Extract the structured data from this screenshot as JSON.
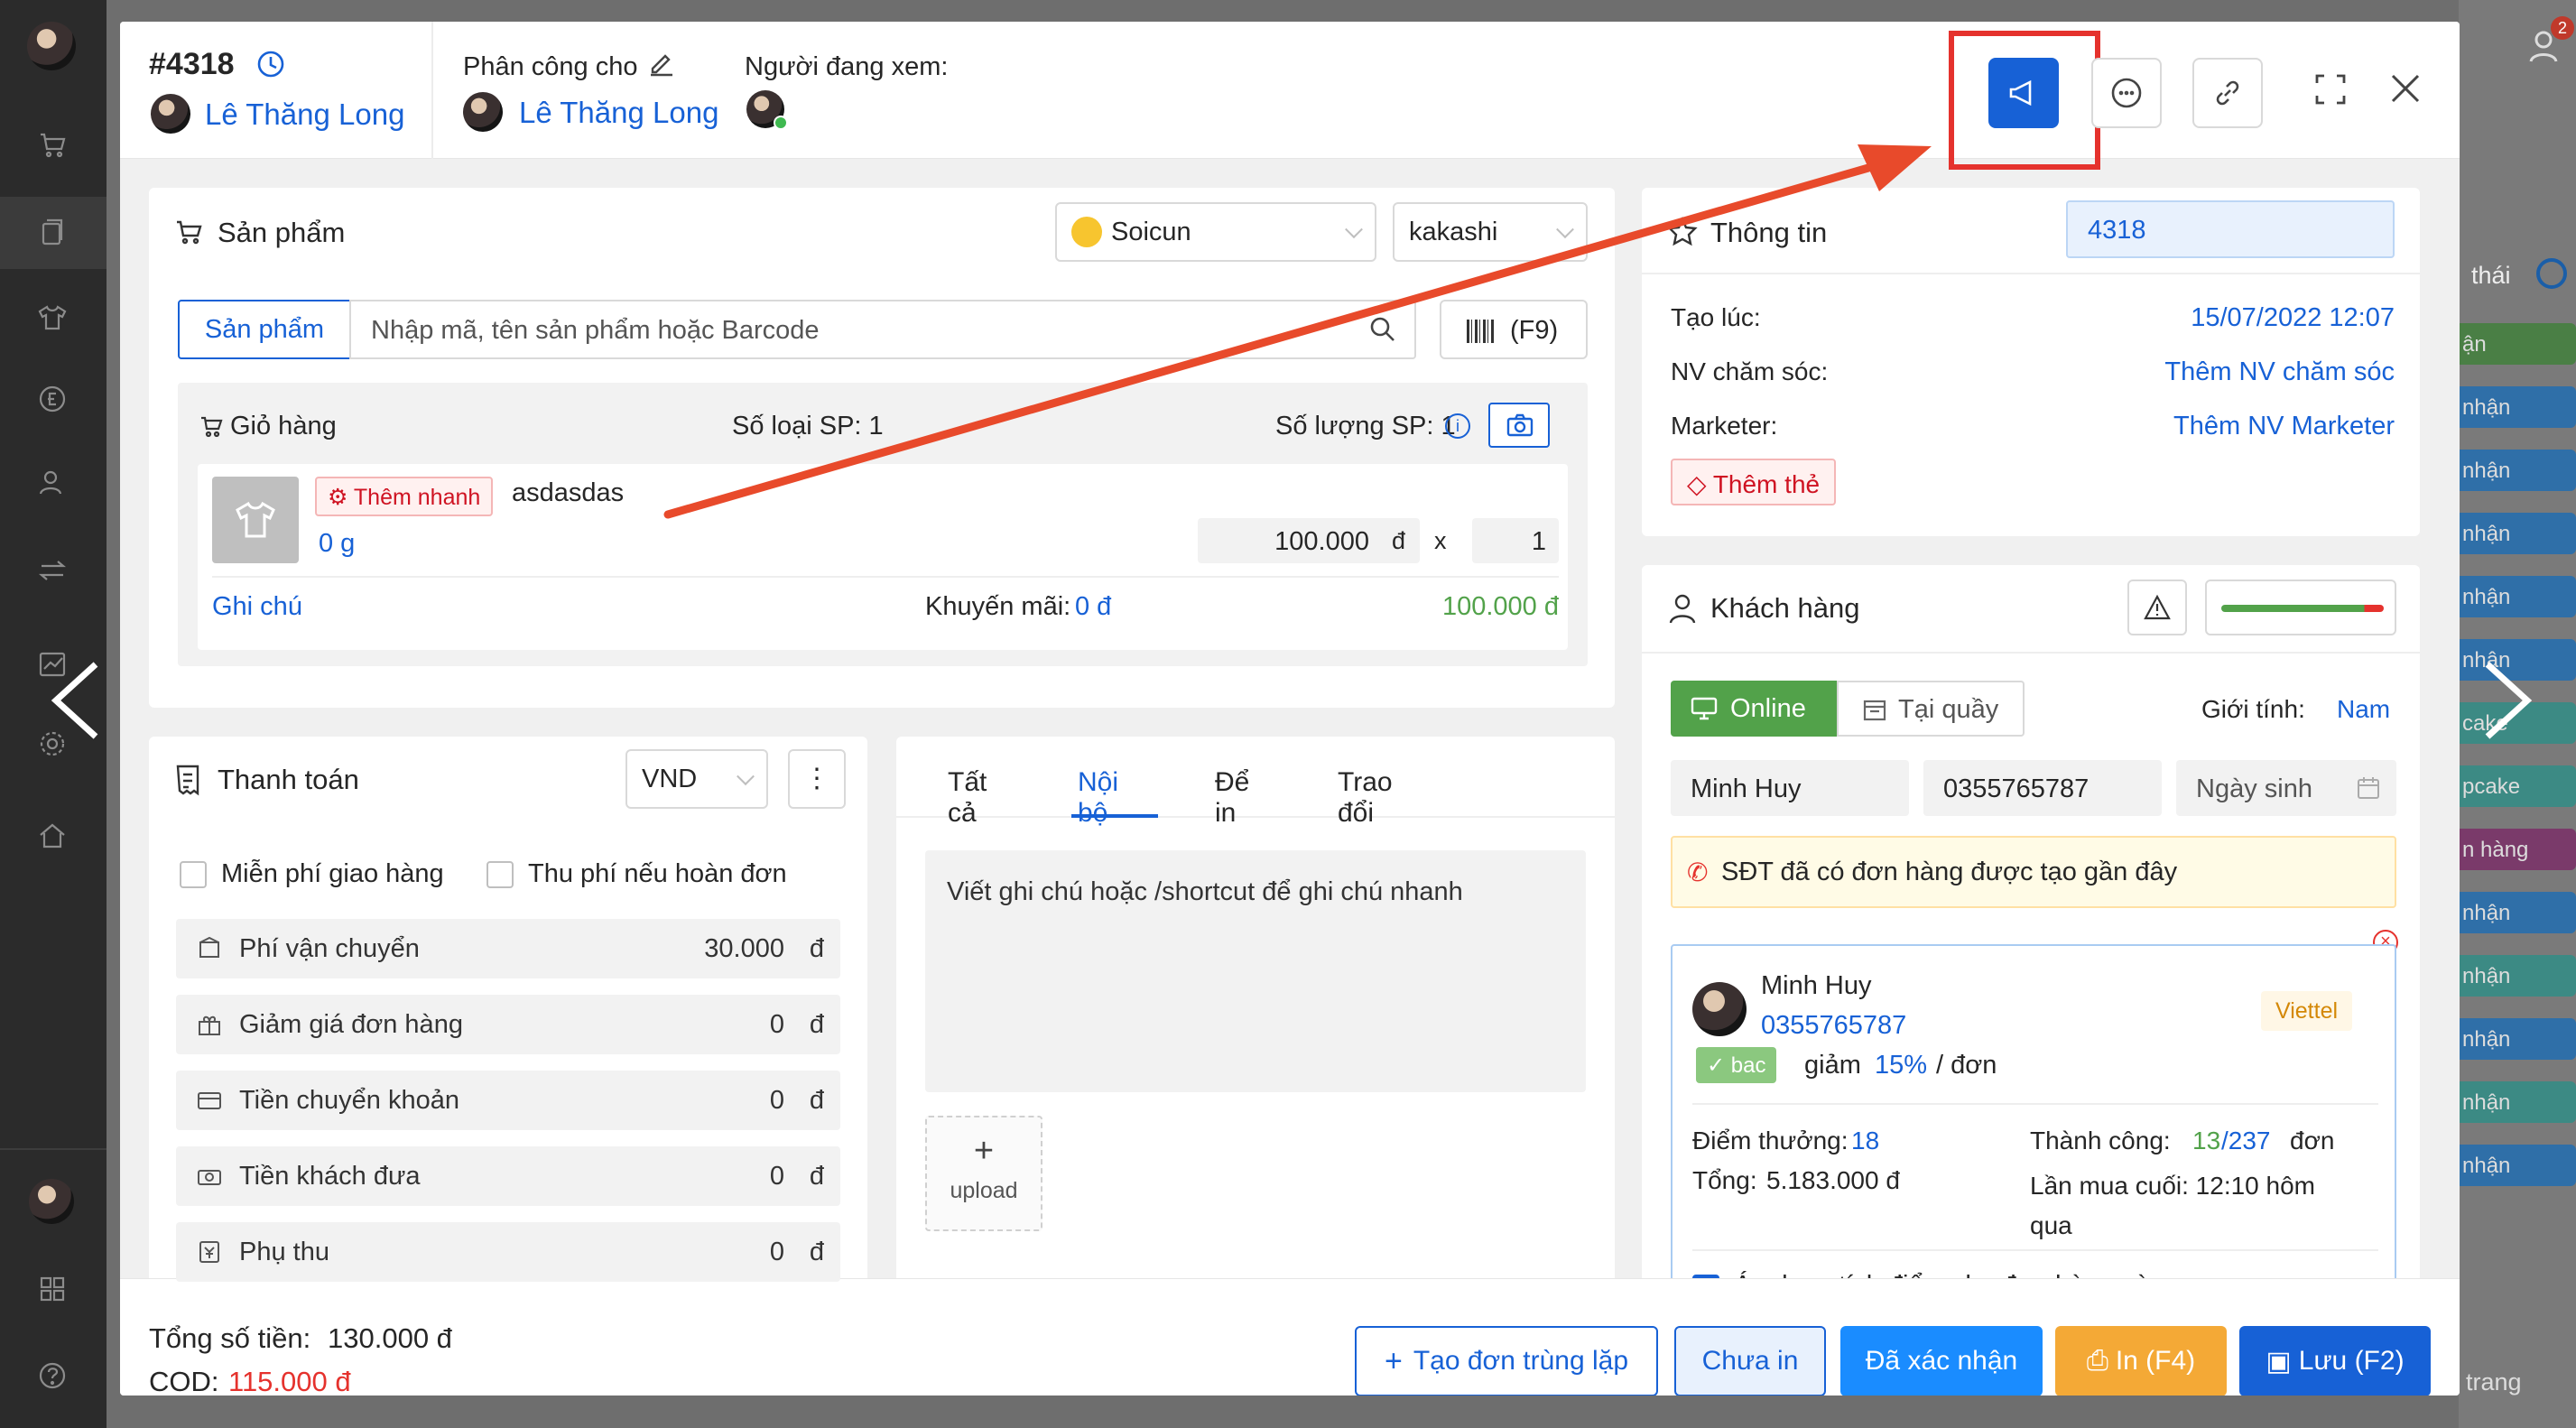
{
  "header": {
    "order_id": "#4318",
    "creator": "Lê Thăng Long",
    "assign_label": "Phân công cho",
    "assignee": "Lê Thăng Long",
    "viewers_label": "Người đang xem:"
  },
  "products": {
    "title": "Sản phẩm",
    "page_select": "Soicun",
    "warehouse_select": "kakashi",
    "tab_label": "Sản phẩm",
    "search_placeholder": "Nhập mã, tên sản phẩm hoặc Barcode",
    "barcode_label": "(F9)",
    "cart_label": "Giỏ hàng",
    "types_count": "Số loại SP: 1",
    "qty_count": "Số lượng SP: 1",
    "item": {
      "quick_add": "Thêm nhanh",
      "name": "asdasdas",
      "weight": "0 g",
      "price": "100.000",
      "currency": "đ",
      "times": "x",
      "qty": "1",
      "note_label": "Ghi chú",
      "discount_label": "Khuyến mãi:",
      "discount_value": "0 đ",
      "total": "100.000 đ"
    }
  },
  "payment": {
    "title": "Thanh toán",
    "currency": "VND",
    "more": "⋮",
    "free_ship": "Miễn phí giao hàng",
    "charge_on_return": "Thu phí nếu hoàn đơn",
    "rows": [
      {
        "label": "Phí vận chuyển",
        "value": "30.000",
        "cur": "đ"
      },
      {
        "label": "Giảm giá đơn hàng",
        "value": "0",
        "cur": "đ"
      },
      {
        "label": "Tiền chuyển khoản",
        "value": "0",
        "cur": "đ"
      },
      {
        "label": "Tiền khách đưa",
        "value": "0",
        "cur": "đ"
      },
      {
        "label": "Phụ thu",
        "value": "0",
        "cur": "đ"
      }
    ]
  },
  "notes": {
    "tabs": [
      "Tất cả",
      "Nội bộ",
      "Để in",
      "Trao đổi"
    ],
    "active_tab": "Nội bộ",
    "placeholder": "Viết ghi chú hoặc /shortcut để ghi chú nhanh",
    "upload_icon": "+",
    "upload": "upload"
  },
  "info": {
    "title": "Thông tin",
    "id_value": "4318",
    "created_label": "Tạo lúc:",
    "created_value": "15/07/2022 12:07",
    "care_label": "NV chăm sóc:",
    "care_value": "Thêm NV chăm sóc",
    "marketer_label": "Marketer:",
    "marketer_value": "Thêm NV Marketer",
    "add_tag": "Thêm thẻ"
  },
  "customer": {
    "title": "Khách hàng",
    "online": "Online",
    "counter": "Tại quầy",
    "gender_label": "Giới tính:",
    "gender_value": "Nam",
    "name": "Minh Huy",
    "phone": "0355765787",
    "dob_placeholder": "Ngày sinh",
    "alert": "SĐT đã có đơn hàng được tạo gần đây",
    "card": {
      "name": "Minh Huy",
      "phone": "0355765787",
      "carrier": "Viettel",
      "level": "bac",
      "discount_prefix": "giảm",
      "discount": "15%",
      "discount_suffix": "/ đơn",
      "points_label": "Điểm thưởng:",
      "points": "18",
      "total_label": "Tổng:",
      "total": "5.183.000 đ",
      "success_label": "Thành công:",
      "success": "13",
      "orders_total": "/237",
      "orders_suffix": "đơn",
      "last_buy": "Lần mua cuối: 12:10 hôm qua"
    },
    "apply_points": "Áp dụng tích điểm cho đơn hàng này"
  },
  "footer": {
    "total_label": "Tổng số tiền:",
    "total_value": "130.000 đ",
    "cod_label": "COD:",
    "cod_value": "115.000 đ",
    "duplicate": "Tạo đơn trùng lặp",
    "not_printed": "Chưa in",
    "confirmed": "Đã xác nhận",
    "print": "In (F4)",
    "save": "Lưu (F2)"
  },
  "background": {
    "badge": "2",
    "status_header": "thái",
    "rows": [
      "ận",
      "nhận",
      "nhận",
      "nhận",
      "nhận",
      "nhận",
      "cake",
      "pcake",
      "n hàng",
      "nhận",
      "nhận",
      "nhận",
      "nhận",
      "nhận"
    ],
    "bottom": "trang"
  },
  "colors": {
    "primary": "#1761d6",
    "success": "#52a24a",
    "warning": "#f4a936",
    "danger": "#e5322d",
    "highlight": "#e84a2b"
  }
}
